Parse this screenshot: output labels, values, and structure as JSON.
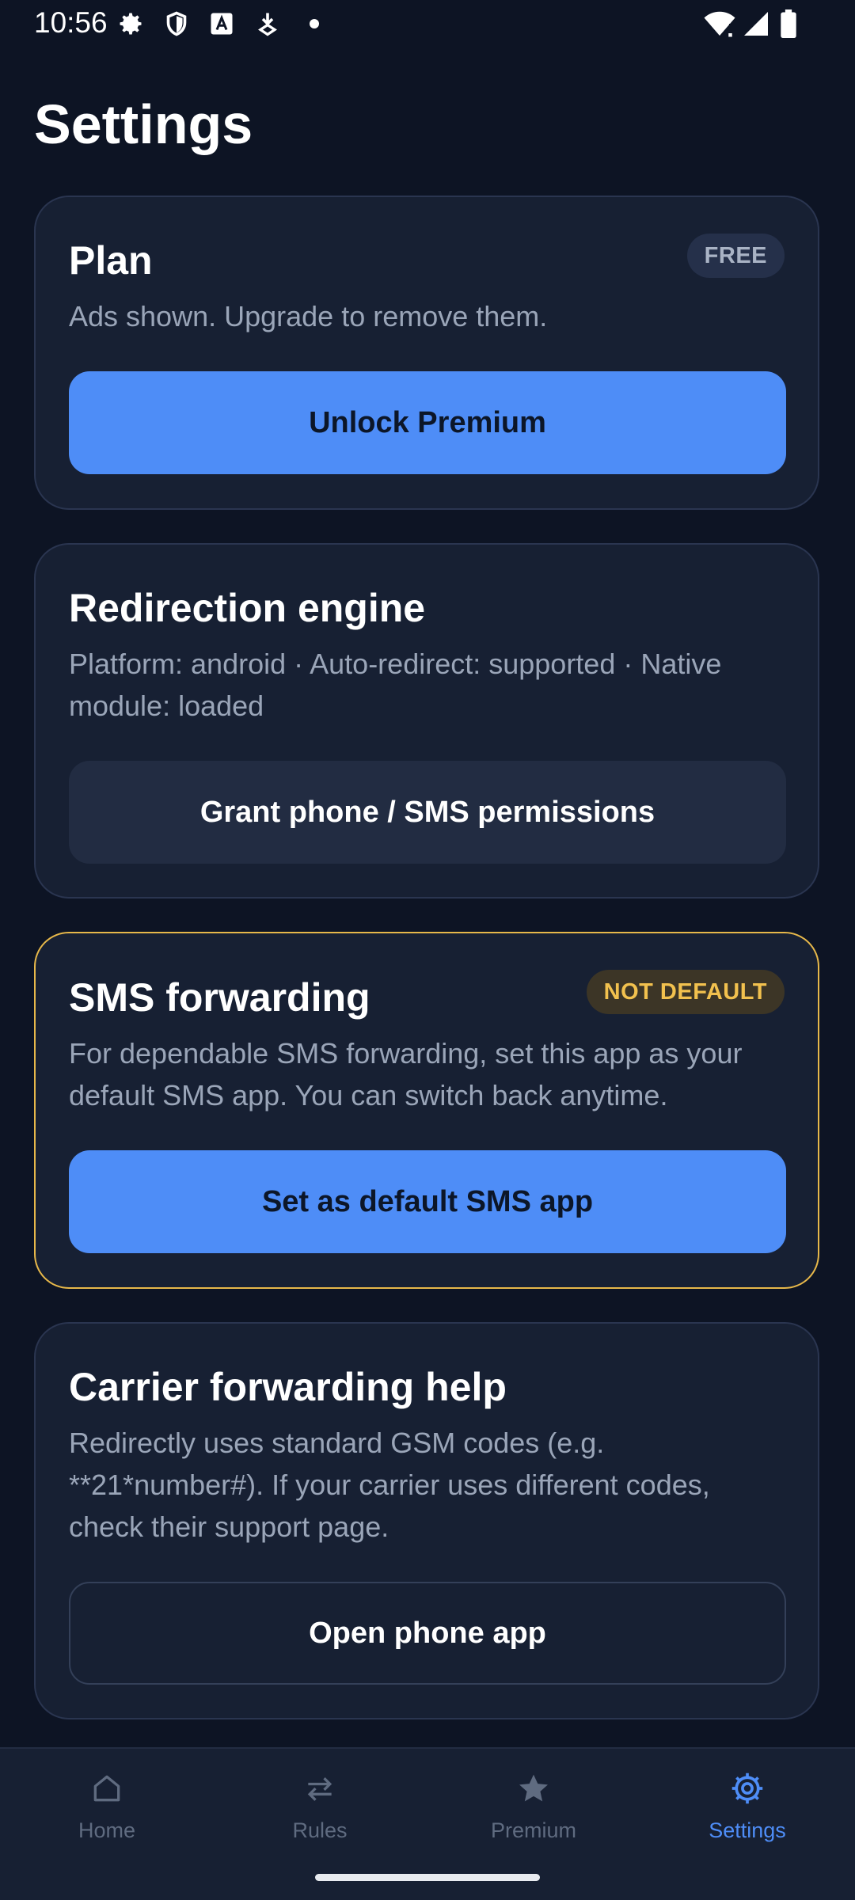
{
  "status_bar": {
    "time": "10:56",
    "icons": [
      "gear-icon",
      "shield-icon",
      "font-a-icon",
      "download-icon",
      "dot-icon",
      "wifi-icon",
      "signal-icon",
      "battery-icon"
    ]
  },
  "page": {
    "title": "Settings"
  },
  "plan_card": {
    "title": "Plan",
    "badge": "FREE",
    "description": "Ads shown. Upgrade to remove them.",
    "button": "Unlock Premium"
  },
  "engine_card": {
    "title": "Redirection engine",
    "description": "Platform: android · Auto-redirect: supported · Native module: loaded",
    "button": "Grant phone / SMS permissions"
  },
  "sms_card": {
    "title": "SMS forwarding",
    "badge": "NOT DEFAULT",
    "description": "For dependable SMS forwarding, set this app as your default SMS app. You can switch back anytime.",
    "button": "Set as default SMS app",
    "accent_color": "#e7b84a"
  },
  "carrier_card": {
    "title": "Carrier forwarding help",
    "description": "Redirectly uses standard GSM codes (e.g. **21*number#). If your carrier uses different codes, check their support page.",
    "button": "Open phone app"
  },
  "bottom_nav": {
    "items": [
      {
        "label": "Home",
        "icon": "home-icon",
        "active": false
      },
      {
        "label": "Rules",
        "icon": "swap-arrows-icon",
        "active": false
      },
      {
        "label": "Premium",
        "icon": "star-icon",
        "active": false
      },
      {
        "label": "Settings",
        "icon": "settings-icon",
        "active": true
      }
    ]
  },
  "colors": {
    "background": "#0d1424",
    "card": "#172033",
    "primary": "#4e8df7",
    "warning": "#f2c14e"
  }
}
